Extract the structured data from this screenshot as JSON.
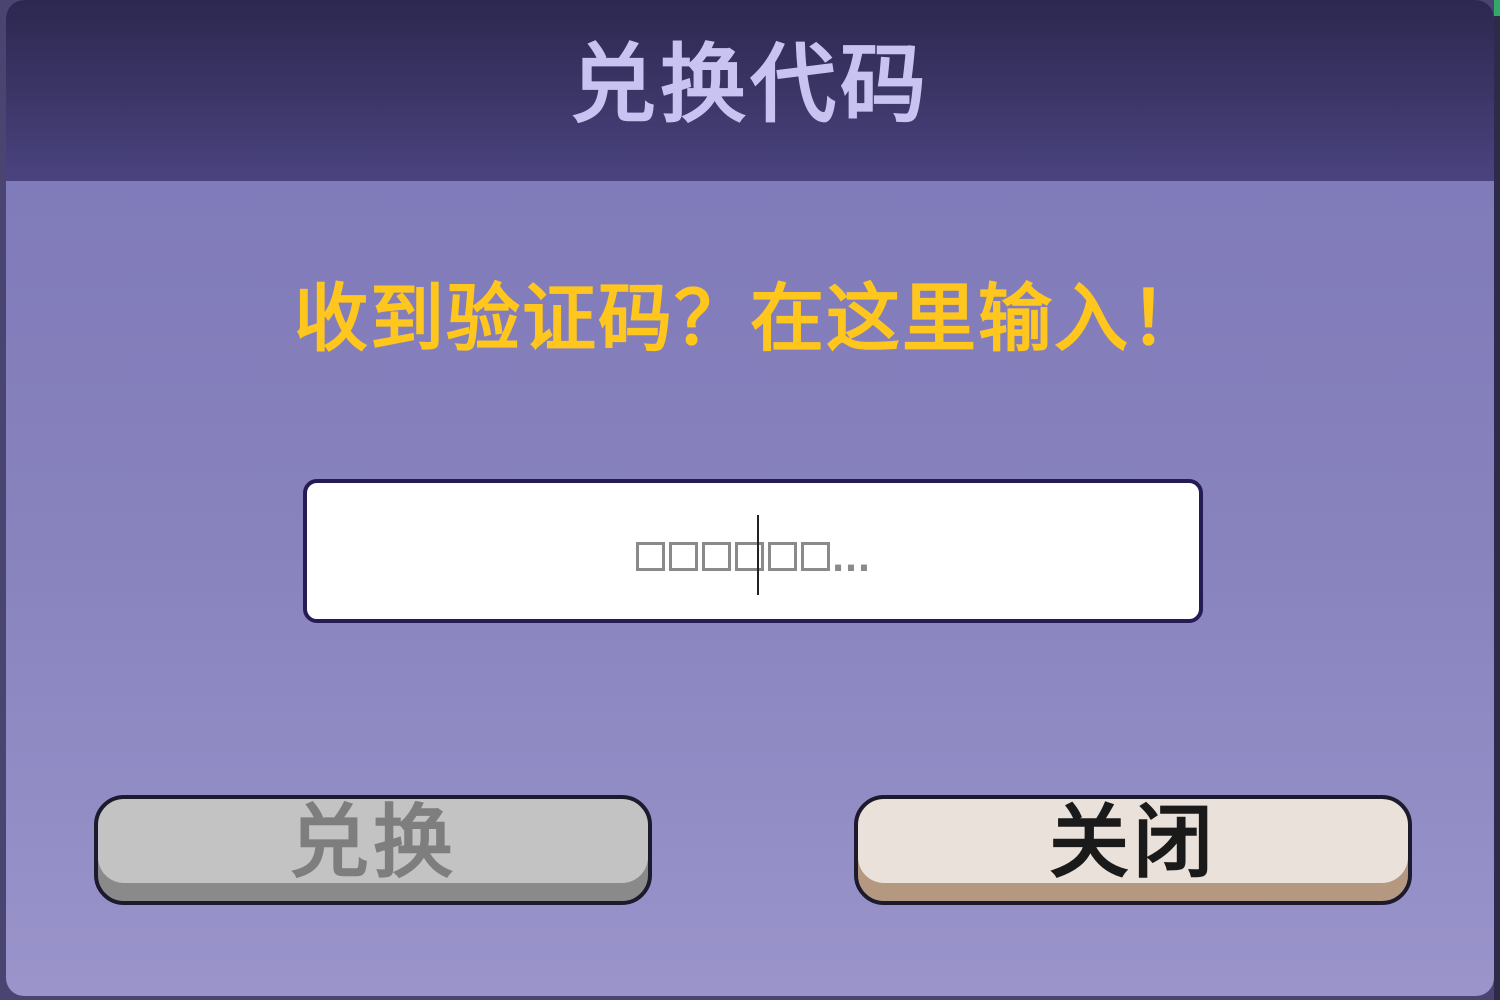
{
  "dialog": {
    "title": "兑换代码",
    "prompt": "收到验证码？在这里输入！",
    "input": {
      "value": "",
      "placeholder_ellipsis": "..."
    },
    "buttons": {
      "redeem_label": "兑换",
      "close_label": "关闭"
    }
  },
  "colors": {
    "title_bar": "#3b3566",
    "panel": "#8883bd",
    "title_text": "#c8c3f0",
    "prompt_text": "#ffc61e",
    "redeem_button_disabled": "#c3c3c3",
    "close_button": "#e9e1da"
  }
}
